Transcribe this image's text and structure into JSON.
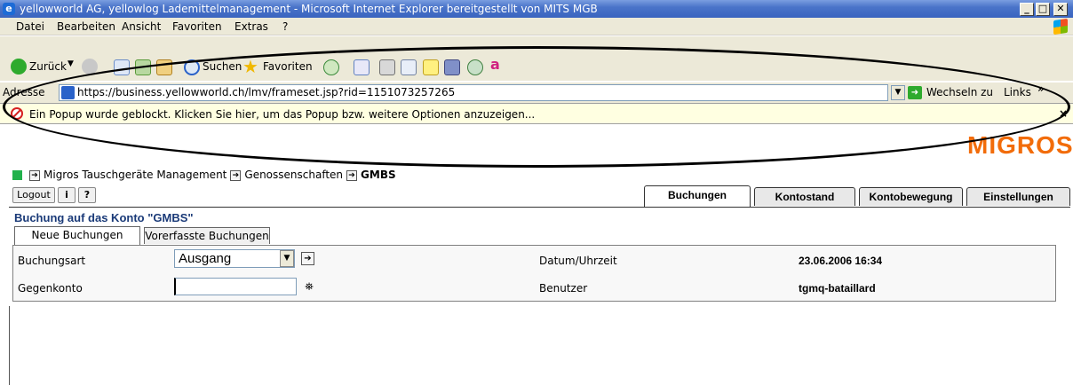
{
  "window": {
    "title": "yellowworld AG, yellowlog Lademittelmanagement - Microsoft Internet Explorer bereitgestellt von MITS MGB",
    "buttons": {
      "minimize": "_",
      "maximize": "□",
      "close": "✕"
    }
  },
  "menu": [
    "Datei",
    "Bearbeiten",
    "Ansicht",
    "Favoriten",
    "Extras",
    "?"
  ],
  "toolbar": {
    "back": "Zurück",
    "search": "Suchen",
    "favorites": "Favoriten"
  },
  "address": {
    "label": "Adresse",
    "url": "https://business.yellowworld.ch/lmv/frameset.jsp?rid=1151073257265",
    "go": "Wechseln zu",
    "links": "Links",
    "more": "»"
  },
  "infobar": {
    "message": "Ein Popup wurde geblockt. Klicken Sie hier, um das Popup bzw. weitere Optionen anzuzeigen...",
    "close": "×"
  },
  "logo": "MIGROS",
  "breadcrumb": [
    "Migros Tauschgeräte Management",
    "Genossenschaften",
    "GMBS"
  ],
  "app_buttons": {
    "logout": "Logout",
    "info": "i",
    "help": "?"
  },
  "main_tabs": [
    "Buchungen",
    "Kontostand",
    "Kontobewegung",
    "Einstellungen"
  ],
  "heading": "Buchung auf das Konto \"GMBS\"",
  "sub_tabs": [
    "Neue Buchungen",
    "Vorerfasste Buchungen"
  ],
  "form": {
    "buchungsart_label": "Buchungsart",
    "buchungsart_value": "Ausgang",
    "gegenkonto_label": "Gegenkonto",
    "gegenkonto_value": "",
    "datum_label": "Datum/Uhrzeit",
    "datum_value": "23.06.2006 16:34",
    "benutzer_label": "Benutzer",
    "benutzer_value": "tgmq-bataillard"
  },
  "colors": {
    "titlebar": "#3a64bf",
    "infobar": "#ffffe1",
    "logo": "#f26c0a",
    "heading": "#1a3a78",
    "status_green": "#22b14c"
  }
}
